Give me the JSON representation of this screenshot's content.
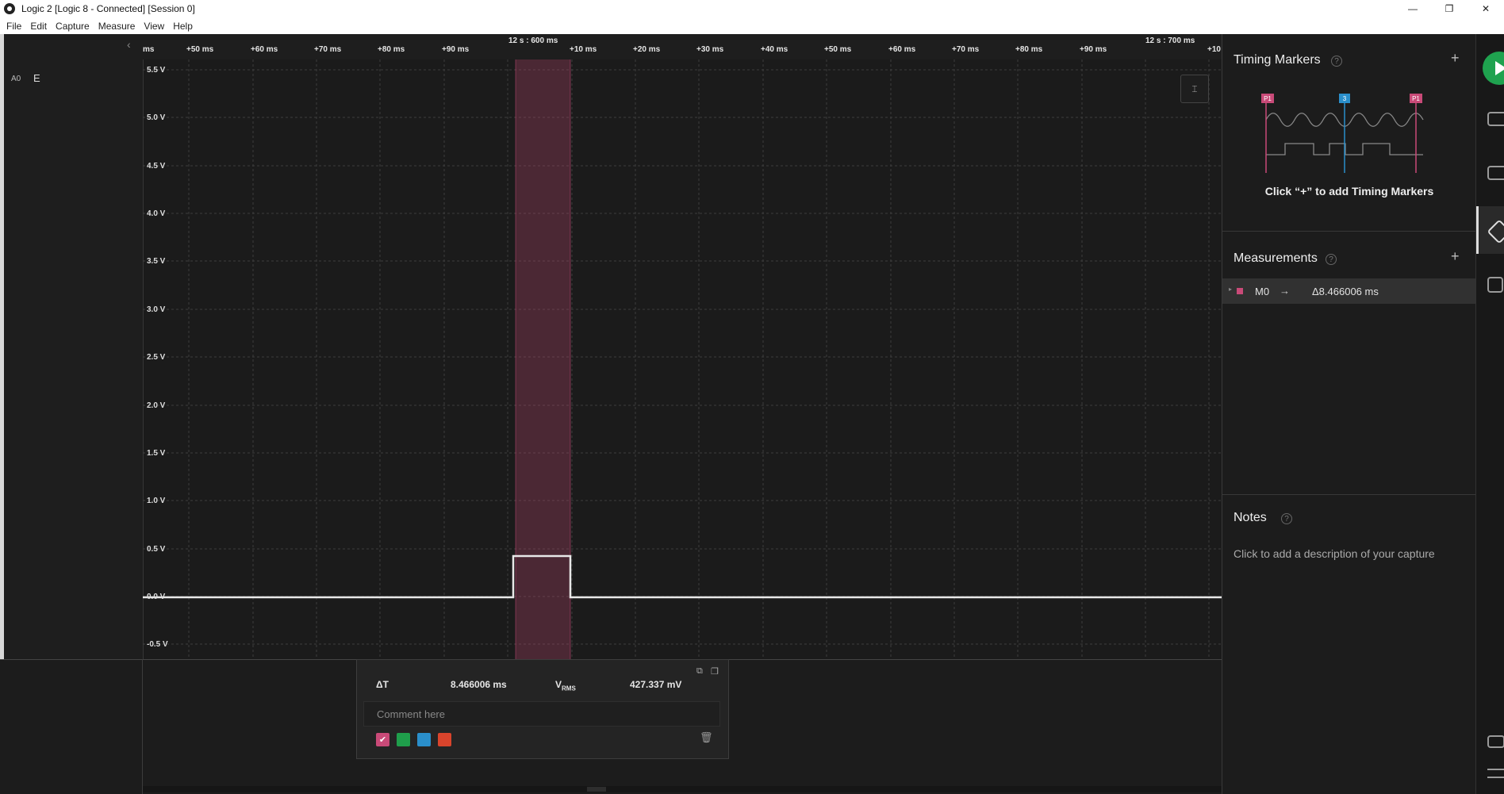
{
  "window": {
    "title": "Logic 2 [Logic 8 - Connected] [Session 0]",
    "minimize": "—",
    "restore": "❐",
    "close": "✕"
  },
  "menu": [
    "File",
    "Edit",
    "Capture",
    "Measure",
    "View",
    "Help"
  ],
  "channel": {
    "label": "A0",
    "name": "E"
  },
  "timeline": {
    "ticks": [
      "ms",
      "+50 ms",
      "+60 ms",
      "+70 ms",
      "+80 ms",
      "+90 ms",
      "+10 ms",
      "+20 ms",
      "+30 ms",
      "+40 ms",
      "+50 ms",
      "+60 ms",
      "+70 ms",
      "+80 ms",
      "+90 ms",
      "+10"
    ],
    "anchor_left": "12 s : 600 ms",
    "anchor_right": "12 s : 700 ms"
  },
  "y_axis": [
    "5.5 V",
    "5.0 V",
    "4.5 V",
    "4.0 V",
    "3.5 V",
    "3.0 V",
    "2.5 V",
    "2.0 V",
    "1.5 V",
    "1.0 V",
    "0.5 V",
    "0.0 V",
    "-0.5 V"
  ],
  "popup": {
    "dt_label": "ΔT",
    "dt_value": "8.466006 ms",
    "vrms_label": "V",
    "vrms_sub": "RMS",
    "vrms_value": "427.337 mV",
    "comment_placeholder": "Comment here",
    "colors": [
      "#c94a78",
      "#1f9e4b",
      "#2a8fcb",
      "#d9442c"
    ]
  },
  "timing_markers": {
    "title": "Timing Markers",
    "hint": "Click “+” to add Timing Markers",
    "marker_labels": [
      "P1",
      "3",
      "P1"
    ]
  },
  "measurements": {
    "title": "Measurements",
    "rows": [
      {
        "name": "M0",
        "arrow": "→",
        "value": "Δ8.466006 ms"
      }
    ]
  },
  "notes": {
    "title": "Notes",
    "hint": "Click to add a description of your capture"
  },
  "help_glyph": "?",
  "plus_glyph": "+",
  "colors": {
    "accent_pink": "#c94a78",
    "signal": "#e8e8e8",
    "play_green": "#1fa24f",
    "marker_blue": "#2a8fcb"
  }
}
